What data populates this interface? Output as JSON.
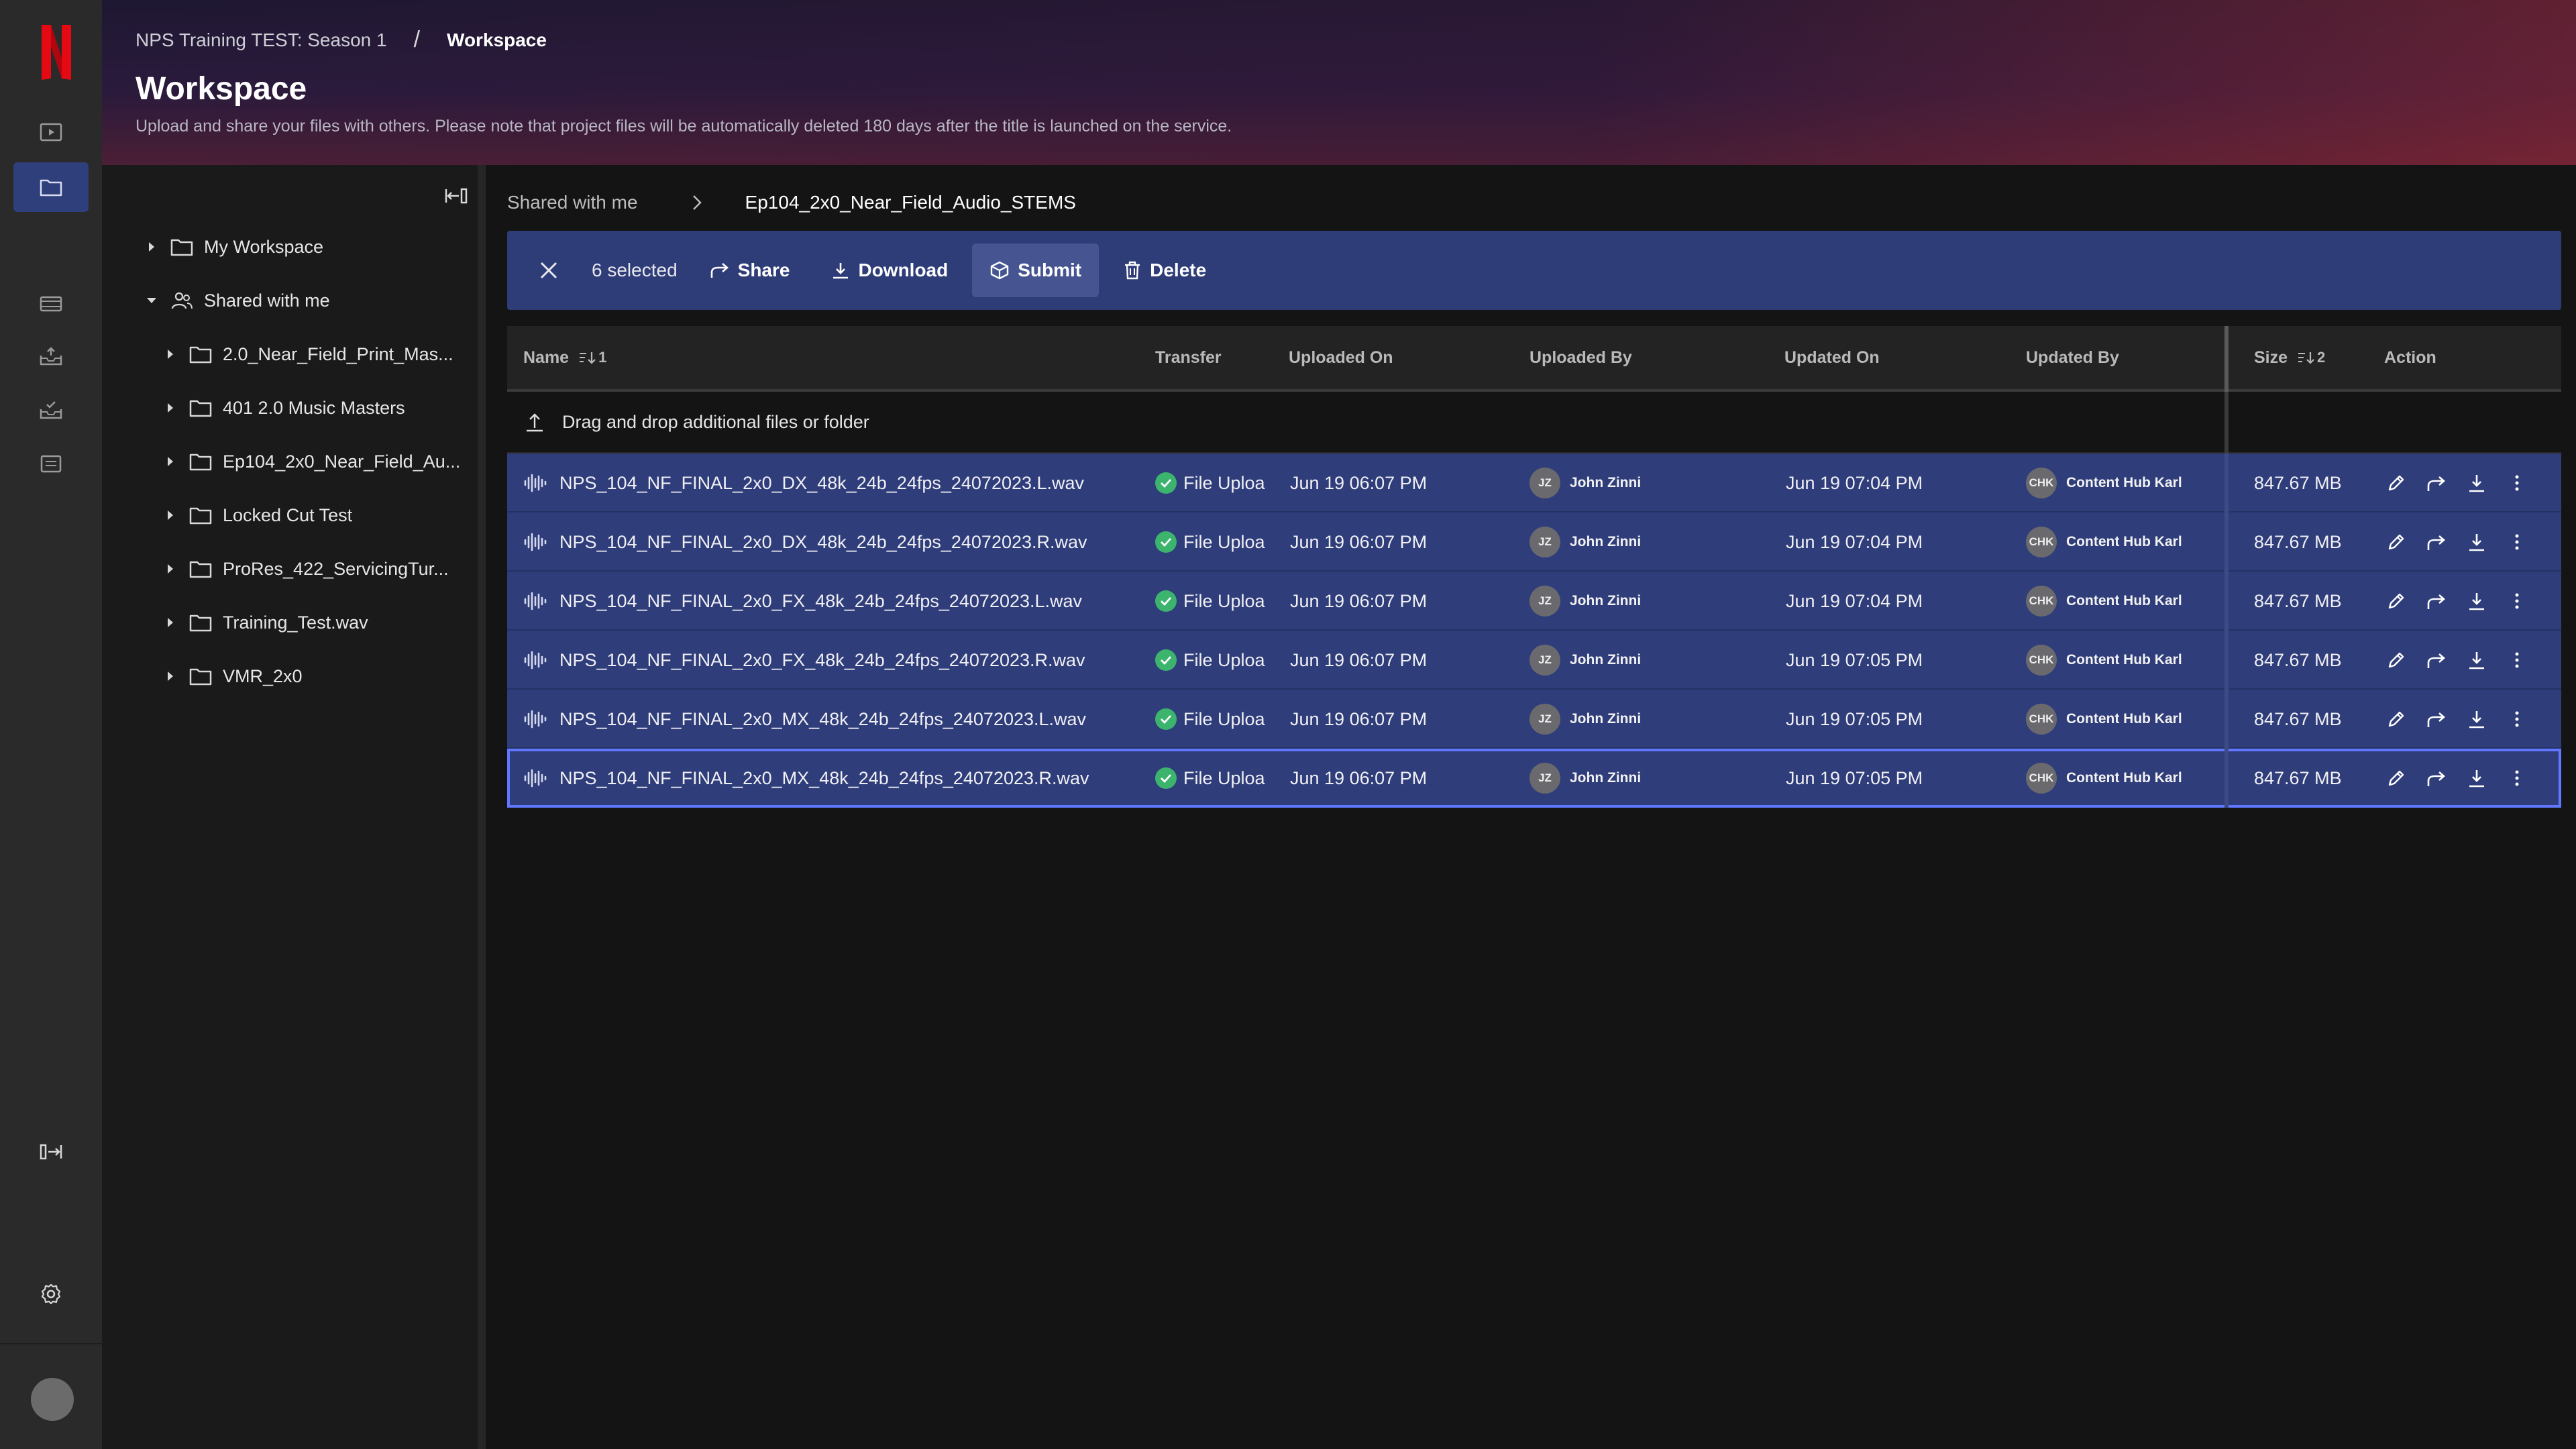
{
  "header": {
    "breadcrumb_project": "NPS Training TEST: Season 1",
    "breadcrumb_separator": "/",
    "breadcrumb_current": "Workspace",
    "title": "Workspace",
    "description": "Upload and share your files with others. Please note that project files will be automatically deleted 180 days after the title is launched on the service."
  },
  "tree": {
    "items": [
      {
        "label": "My Workspace",
        "icon": "folder-icon"
      },
      {
        "label": "Shared with me",
        "icon": "shared-users-icon"
      },
      {
        "label": "2.0_Near_Field_Print_Mas...",
        "icon": "folder-icon"
      },
      {
        "label": "401 2.0 Music Masters",
        "icon": "folder-icon"
      },
      {
        "label": "Ep104_2x0_Near_Field_Au...",
        "icon": "folder-icon"
      },
      {
        "label": "Locked Cut Test",
        "icon": "folder-icon"
      },
      {
        "label": "ProRes_422_ServicingTur...",
        "icon": "folder-icon"
      },
      {
        "label": "Training_Test.wav",
        "icon": "folder-icon"
      },
      {
        "label": "VMR_2x0",
        "icon": "folder-icon"
      }
    ]
  },
  "crumbs": {
    "parent": "Shared with me",
    "current": "Ep104_2x0_Near_Field_Audio_STEMS"
  },
  "actionbar": {
    "count": "6 selected",
    "share": "Share",
    "download": "Download",
    "submit": "Submit",
    "delete": "Delete"
  },
  "table": {
    "columns": {
      "name": "Name",
      "name_sort": "1",
      "transfer": "Transfer",
      "uploaded_on": "Uploaded On",
      "uploaded_by": "Uploaded By",
      "updated_on": "Updated On",
      "updated_by": "Updated By",
      "size": "Size",
      "size_sort": "2",
      "action": "Action"
    },
    "drop_text": "Drag and drop additional files or folder",
    "rows": [
      {
        "name": "NPS_104_NF_FINAL_2x0_DX_48k_24b_24fps_24072023.L.wav",
        "transfer": "File Uploa",
        "uploaded_on": "Jun 19 06:07 PM",
        "uploader_initials": "JZ",
        "uploader": "John Zinni",
        "updated_on": "Jun 19 07:04 PM",
        "updater_initials": "CHK",
        "updater": "Content Hub Karl",
        "size": "847.67 MB"
      },
      {
        "name": "NPS_104_NF_FINAL_2x0_DX_48k_24b_24fps_24072023.R.wav",
        "transfer": "File Uploa",
        "uploaded_on": "Jun 19 06:07 PM",
        "uploader_initials": "JZ",
        "uploader": "John Zinni",
        "updated_on": "Jun 19 07:04 PM",
        "updater_initials": "CHK",
        "updater": "Content Hub Karl",
        "size": "847.67 MB"
      },
      {
        "name": "NPS_104_NF_FINAL_2x0_FX_48k_24b_24fps_24072023.L.wav",
        "transfer": "File Uploa",
        "uploaded_on": "Jun 19 06:07 PM",
        "uploader_initials": "JZ",
        "uploader": "John Zinni",
        "updated_on": "Jun 19 07:04 PM",
        "updater_initials": "CHK",
        "updater": "Content Hub Karl",
        "size": "847.67 MB"
      },
      {
        "name": "NPS_104_NF_FINAL_2x0_FX_48k_24b_24fps_24072023.R.wav",
        "transfer": "File Uploa",
        "uploaded_on": "Jun 19 06:07 PM",
        "uploader_initials": "JZ",
        "uploader": "John Zinni",
        "updated_on": "Jun 19 07:05 PM",
        "updater_initials": "CHK",
        "updater": "Content Hub Karl",
        "size": "847.67 MB"
      },
      {
        "name": "NPS_104_NF_FINAL_2x0_MX_48k_24b_24fps_24072023.L.wav",
        "transfer": "File Uploa",
        "uploaded_on": "Jun 19 06:07 PM",
        "uploader_initials": "JZ",
        "uploader": "John Zinni",
        "updated_on": "Jun 19 07:05 PM",
        "updater_initials": "CHK",
        "updater": "Content Hub Karl",
        "size": "847.67 MB"
      },
      {
        "name": "NPS_104_NF_FINAL_2x0_MX_48k_24b_24fps_24072023.R.wav",
        "transfer": "File Uploa",
        "uploaded_on": "Jun 19 06:07 PM",
        "uploader_initials": "JZ",
        "uploader": "John Zinni",
        "updated_on": "Jun 19 07:05 PM",
        "updater_initials": "CHK",
        "updater": "Content Hub Karl",
        "size": "847.67 MB"
      }
    ]
  },
  "colors": {
    "accent": "#2f3d7a",
    "brand": "#e50914",
    "success": "#3cb46e"
  }
}
